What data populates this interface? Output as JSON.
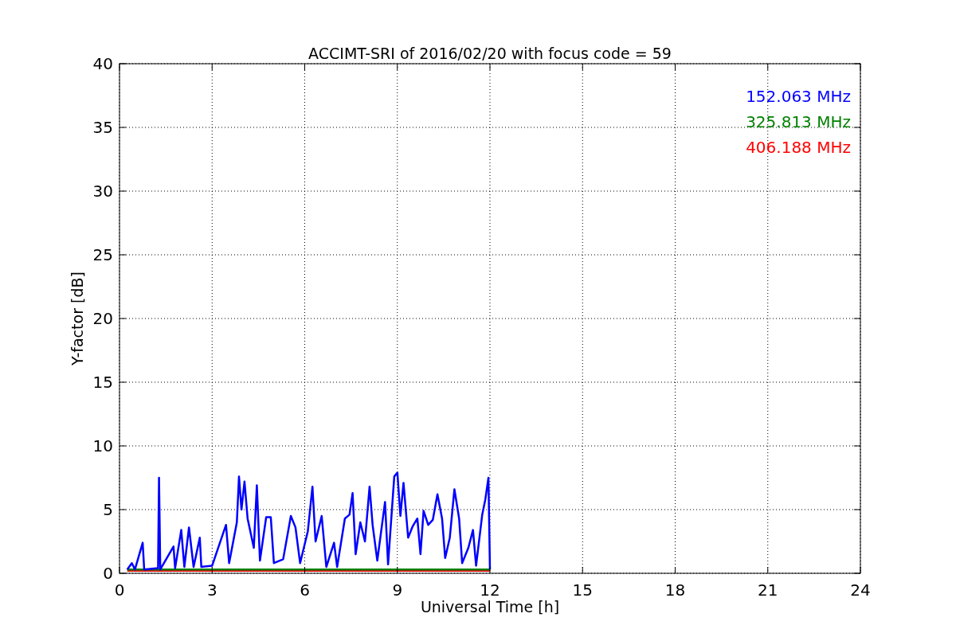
{
  "chart_data": {
    "type": "line",
    "grid": true,
    "title": "ACCIMT-SRI of 2016/02/20 with focus code = 59",
    "xlabel": "Universal Time [h]",
    "ylabel": "Y-factor [dB]",
    "xlim": [
      0,
      24
    ],
    "ylim": [
      0,
      40
    ],
    "xticks": [
      0,
      3,
      6,
      9,
      12,
      15,
      18,
      21,
      24
    ],
    "yticks": [
      0,
      5,
      10,
      15,
      20,
      25,
      30,
      35,
      40
    ],
    "x": [
      0.25,
      0.4,
      0.5,
      0.75,
      0.8,
      1.25,
      1.28,
      1.32,
      1.75,
      1.8,
      2.0,
      2.1,
      2.25,
      2.4,
      2.6,
      2.65,
      3.0,
      3.45,
      3.55,
      3.8,
      3.87,
      3.95,
      4.05,
      4.15,
      4.35,
      4.45,
      4.55,
      4.75,
      4.9,
      5.0,
      5.3,
      5.55,
      5.7,
      5.85,
      6.1,
      6.25,
      6.35,
      6.55,
      6.7,
      6.95,
      7.05,
      7.3,
      7.45,
      7.55,
      7.65,
      7.8,
      7.95,
      8.1,
      8.2,
      8.35,
      8.6,
      8.7,
      8.9,
      9.0,
      9.1,
      9.2,
      9.35,
      9.5,
      9.65,
      9.75,
      9.85,
      10.0,
      10.15,
      10.3,
      10.45,
      10.55,
      10.7,
      10.85,
      11.0,
      11.1,
      11.3,
      11.45,
      11.55,
      11.75,
      11.85,
      11.95,
      12.0
    ],
    "series": [
      {
        "name": "152.063 MHz",
        "color": "#0000ff",
        "values": [
          0.3,
          0.8,
          0.3,
          2.4,
          0.3,
          0.4,
          7.5,
          0.3,
          2.1,
          0.4,
          3.4,
          0.5,
          3.6,
          0.5,
          2.8,
          0.5,
          0.6,
          3.8,
          0.8,
          4.0,
          7.6,
          5,
          7.2,
          4.3,
          2,
          6.9,
          1,
          4.4,
          4.4,
          0.8,
          1.1,
          4.5,
          3.6,
          0.8,
          3.3,
          6.8,
          2.5,
          4.5,
          0.5,
          2.4,
          0.5,
          4.3,
          4.6,
          6.3,
          1.5,
          4,
          2.5,
          6.8,
          3.8,
          1,
          5.6,
          0.7,
          7.6,
          7.9,
          4.5,
          7.1,
          2.8,
          3.7,
          4.3,
          1.5,
          4.9,
          3.8,
          4.2,
          6.2,
          4.3,
          1.2,
          2.8,
          6.6,
          4.3,
          0.8,
          2.0,
          3.4,
          0.6,
          4.6,
          5.8,
          7.5,
          0.3
        ]
      },
      {
        "name": "325.813 MHz",
        "color": "#008000",
        "values": [
          0.3,
          0.3,
          0.3,
          0.3,
          0.3,
          0.3,
          0.3,
          0.3,
          0.3,
          0.3,
          0.3,
          0.3,
          0.3,
          0.3,
          0.3,
          0.3,
          0.3,
          0.3,
          0.3,
          0.3,
          0.3,
          0.3,
          0.3,
          0.3,
          0.3,
          0.3,
          0.3,
          0.3,
          0.3,
          0.3,
          0.3,
          0.3,
          0.3,
          0.3,
          0.3,
          0.3,
          0.3,
          0.3,
          0.3,
          0.3,
          0.3,
          0.3,
          0.3,
          0.3,
          0.3,
          0.3,
          0.3,
          0.3,
          0.3,
          0.3,
          0.3,
          0.3,
          0.3,
          0.3,
          0.3,
          0.3,
          0.3,
          0.3,
          0.3,
          0.3,
          0.3,
          0.3,
          0.3,
          0.3,
          0.3,
          0.3,
          0.3,
          0.3,
          0.3,
          0.3,
          0.3,
          0.3,
          0.3,
          0.3,
          0.3,
          0.3,
          0.3
        ]
      },
      {
        "name": "406.188 MHz",
        "color": "#ff0000",
        "values": [
          0.2,
          0.2,
          0.2,
          0.2,
          0.2,
          0.2,
          0.2,
          0.2,
          0.2,
          0.2,
          0.2,
          0.2,
          0.2,
          0.2,
          0.2,
          0.2,
          0.2,
          0.2,
          0.2,
          0.2,
          0.2,
          0.2,
          0.2,
          0.2,
          0.2,
          0.2,
          0.2,
          0.2,
          0.2,
          0.2,
          0.2,
          0.2,
          0.2,
          0.2,
          0.2,
          0.2,
          0.2,
          0.2,
          0.2,
          0.2,
          0.2,
          0.2,
          0.2,
          0.2,
          0.2,
          0.2,
          0.2,
          0.2,
          0.2,
          0.2,
          0.2,
          0.2,
          0.2,
          0.2,
          0.2,
          0.2,
          0.2,
          0.2,
          0.2,
          0.2,
          0.2,
          0.2,
          0.2,
          0.2,
          0.2,
          0.2,
          0.2,
          0.2,
          0.2,
          0.2,
          0.2,
          0.2,
          0.2,
          0.2,
          0.2,
          0.2,
          0.2
        ]
      }
    ]
  }
}
